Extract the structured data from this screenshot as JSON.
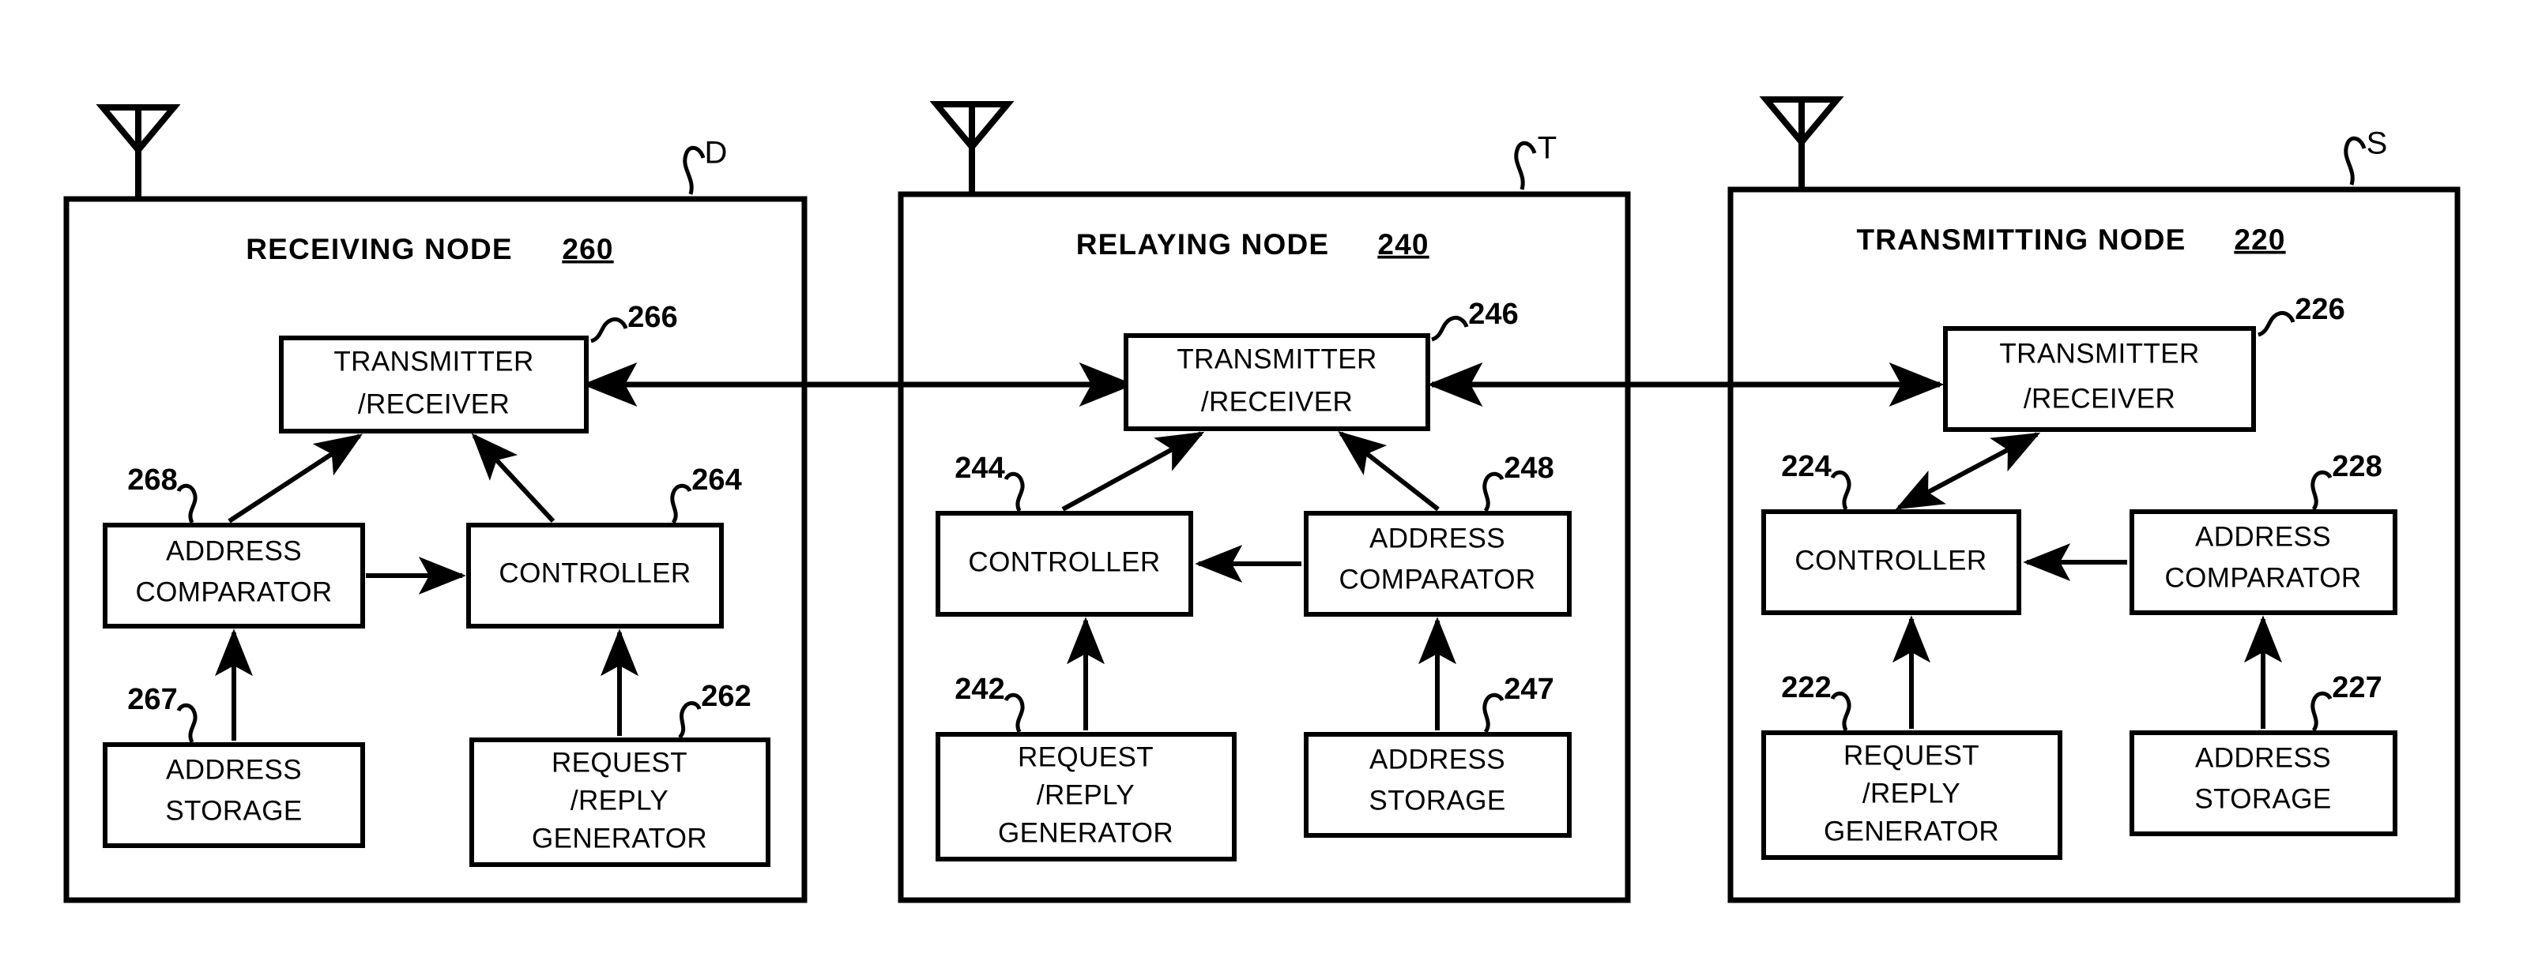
{
  "figure": {
    "kind": "patent-block-diagram",
    "background_color": "#ffffff",
    "line_color": "#000000"
  },
  "nodes": [
    {
      "id": "receiving",
      "title": "RECEIVING NODE",
      "title_number": "260",
      "letter": "D",
      "antenna": "antenna-icon",
      "units": [
        {
          "id": "transceiver",
          "ref": "266",
          "lines": [
            "TRANSMITTER",
            "/RECEIVER"
          ]
        },
        {
          "id": "address-comparator",
          "ref": "268",
          "lines": [
            "ADDRESS",
            "COMPARATOR"
          ]
        },
        {
          "id": "controller",
          "ref": "264",
          "lines": [
            "CONTROLLER"
          ]
        },
        {
          "id": "address-storage",
          "ref": "267",
          "lines": [
            "ADDRESS",
            "STORAGE"
          ]
        },
        {
          "id": "request-reply-generator",
          "ref": "262",
          "lines": [
            "REQUEST",
            "/REPLY",
            "GENERATOR"
          ]
        }
      ]
    },
    {
      "id": "relaying",
      "title": "RELAYING NODE",
      "title_number": "240",
      "letter": "T",
      "antenna": "antenna-icon",
      "units": [
        {
          "id": "transceiver",
          "ref": "246",
          "lines": [
            "TRANSMITTER",
            "/RECEIVER"
          ]
        },
        {
          "id": "controller",
          "ref": "244",
          "lines": [
            "CONTROLLER"
          ]
        },
        {
          "id": "address-comparator",
          "ref": "248",
          "lines": [
            "ADDRESS",
            "COMPARATOR"
          ]
        },
        {
          "id": "request-reply-generator",
          "ref": "242",
          "lines": [
            "REQUEST",
            "/REPLY",
            "GENERATOR"
          ]
        },
        {
          "id": "address-storage",
          "ref": "247",
          "lines": [
            "ADDRESS",
            "STORAGE"
          ]
        }
      ]
    },
    {
      "id": "transmitting",
      "title": "TRANSMITTING NODE",
      "title_number": "220",
      "letter": "S",
      "antenna": "antenna-icon",
      "units": [
        {
          "id": "transceiver",
          "ref": "226",
          "lines": [
            "TRANSMITTER",
            "/RECEIVER"
          ]
        },
        {
          "id": "controller",
          "ref": "224",
          "lines": [
            "CONTROLLER"
          ]
        },
        {
          "id": "address-comparator",
          "ref": "228",
          "lines": [
            "ADDRESS",
            "COMPARATOR"
          ]
        },
        {
          "id": "request-reply-generator",
          "ref": "222",
          "lines": [
            "REQUEST",
            "/REPLY",
            "GENERATOR"
          ]
        },
        {
          "id": "address-storage",
          "ref": "227",
          "lines": [
            "ADDRESS",
            "STORAGE"
          ]
        }
      ]
    }
  ],
  "text": {
    "n1_title": "RECEIVING NODE",
    "n1_num": "260",
    "n1_letter": "D",
    "n1_u266_l1": "TRANSMITTER",
    "n1_u266_l2": "/RECEIVER",
    "n1_u266_ref": "266",
    "n1_u268_l1": "ADDRESS",
    "n1_u268_l2": "COMPARATOR",
    "n1_u268_ref": "268",
    "n1_u264_l1": "CONTROLLER",
    "n1_u264_ref": "264",
    "n1_u267_l1": "ADDRESS",
    "n1_u267_l2": "STORAGE",
    "n1_u267_ref": "267",
    "n1_u262_l1": "REQUEST",
    "n1_u262_l2": "/REPLY",
    "n1_u262_l3": "GENERATOR",
    "n1_u262_ref": "262",
    "n2_title": "RELAYING NODE",
    "n2_num": "240",
    "n2_letter": "T",
    "n2_u246_l1": "TRANSMITTER",
    "n2_u246_l2": "/RECEIVER",
    "n2_u246_ref": "246",
    "n2_u244_l1": "CONTROLLER",
    "n2_u244_ref": "244",
    "n2_u248_l1": "ADDRESS",
    "n2_u248_l2": "COMPARATOR",
    "n2_u248_ref": "248",
    "n2_u242_l1": "REQUEST",
    "n2_u242_l2": "/REPLY",
    "n2_u242_l3": "GENERATOR",
    "n2_u242_ref": "242",
    "n2_u247_l1": "ADDRESS",
    "n2_u247_l2": "STORAGE",
    "n2_u247_ref": "247",
    "n3_title": "TRANSMITTING NODE",
    "n3_num": "220",
    "n3_letter": "S",
    "n3_u226_l1": "TRANSMITTER",
    "n3_u226_l2": "/RECEIVER",
    "n3_u226_ref": "226",
    "n3_u224_l1": "CONTROLLER",
    "n3_u224_ref": "224",
    "n3_u228_l1": "ADDRESS",
    "n3_u228_l2": "COMPARATOR",
    "n3_u228_ref": "228",
    "n3_u222_l1": "REQUEST",
    "n3_u222_l2": "/REPLY",
    "n3_u222_l3": "GENERATOR",
    "n3_u222_ref": "222",
    "n3_u227_l1": "ADDRESS",
    "n3_u227_l2": "STORAGE",
    "n3_u227_ref": "227"
  }
}
